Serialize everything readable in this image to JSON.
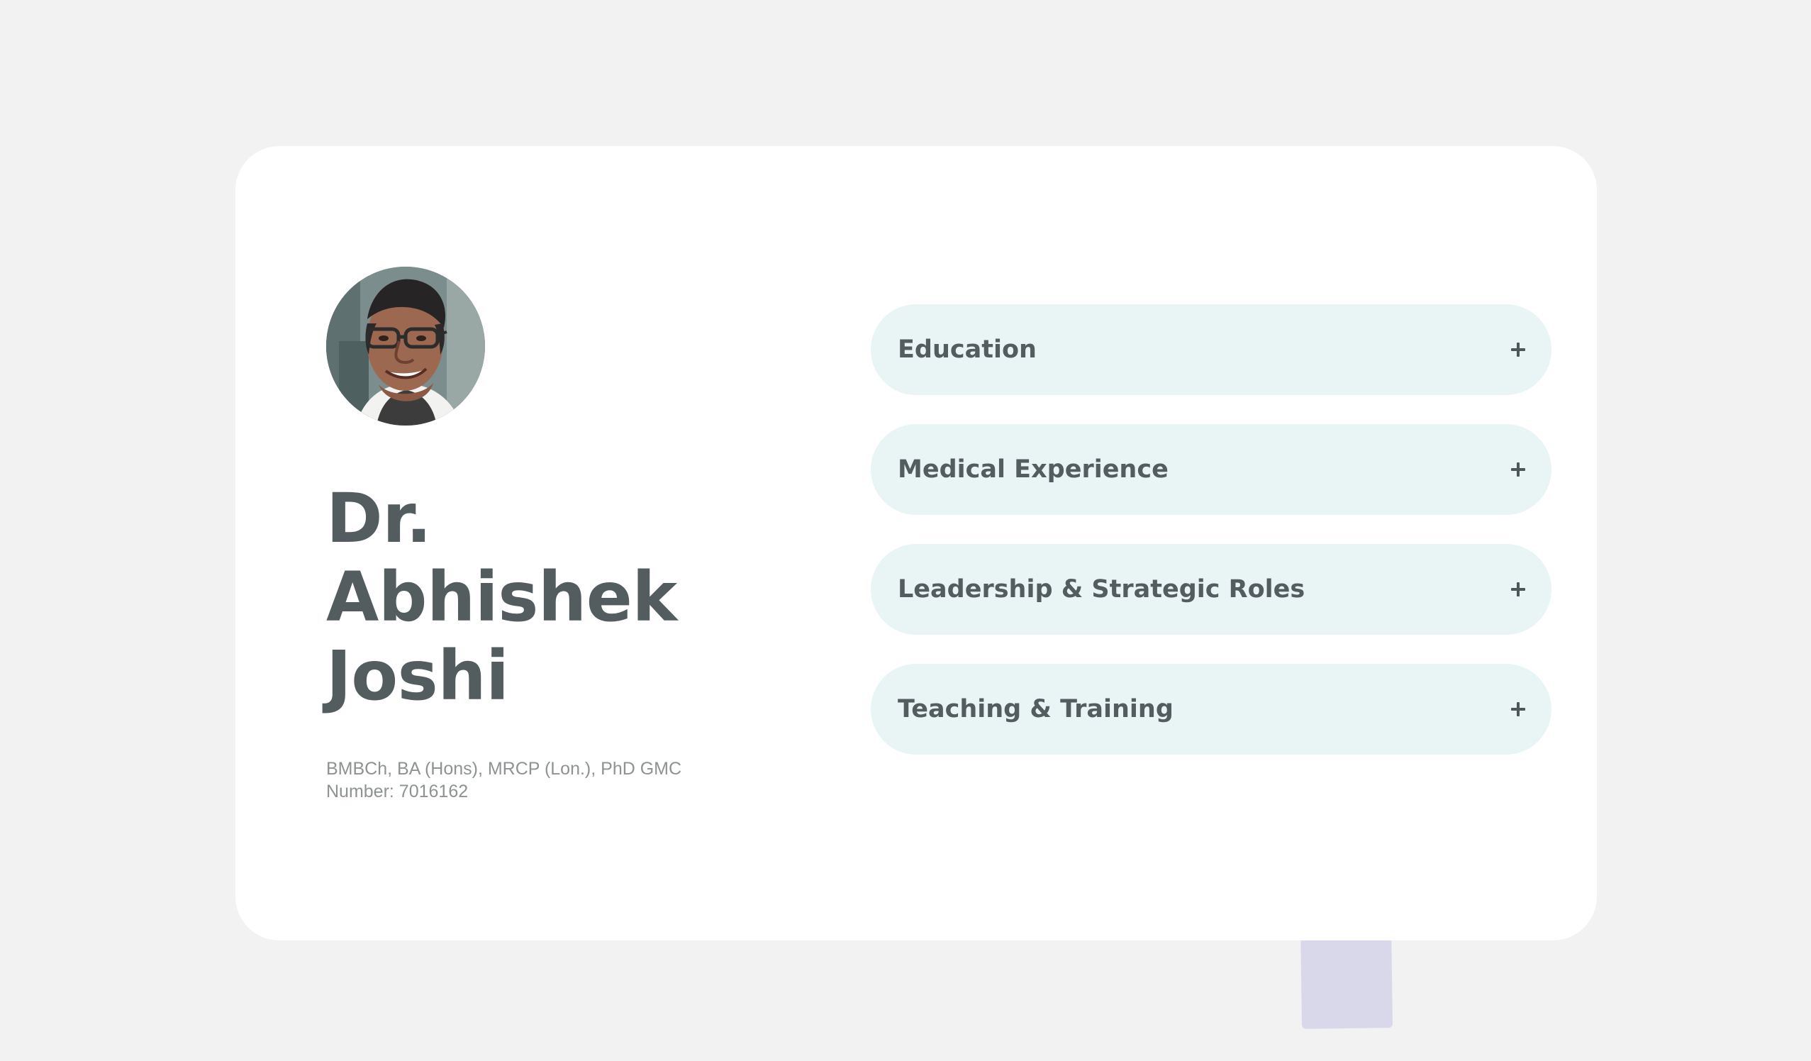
{
  "profile": {
    "avatar_icon": "doctor-portrait-photo",
    "name_lines": [
      "Dr.",
      "Abhishek",
      "Joshi"
    ],
    "credentials_line_1": "BMBCh, BA (Hons), MRCP (Lon.), PhD GMC",
    "credentials_line_2": "Number: 7016162"
  },
  "accordion": {
    "items": [
      {
        "label": "Education",
        "icon": "plus-icon"
      },
      {
        "label": "Medical Experience",
        "icon": "plus-icon"
      },
      {
        "label": "Leadership & Strategic Roles",
        "icon": "plus-icon"
      },
      {
        "label": "Teaching & Training",
        "icon": "plus-icon"
      }
    ]
  },
  "colors": {
    "page_background": "#f2f2f2",
    "card_background": "#ffffff",
    "accordion_background": "#e9f4f5",
    "heading_text": "#535d5f",
    "secondary_text": "#8d9393",
    "decorative_tab": "#d8d8ea"
  }
}
